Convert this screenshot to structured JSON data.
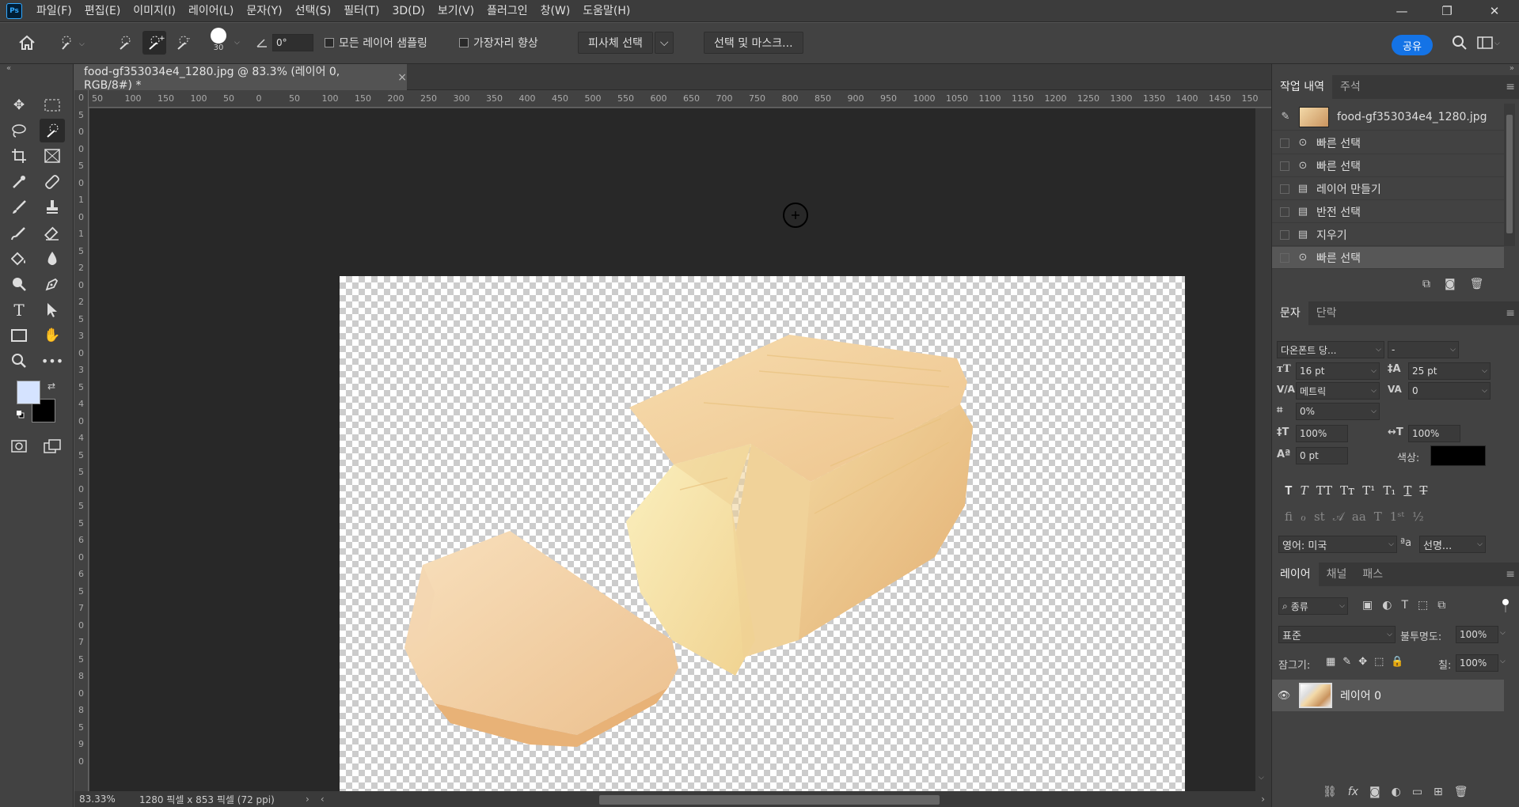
{
  "app": {
    "logo": "Ps"
  },
  "menu": [
    "파일(F)",
    "편집(E)",
    "이미지(I)",
    "레이어(L)",
    "문자(Y)",
    "선택(S)",
    "필터(T)",
    "3D(D)",
    "보기(V)",
    "플러그인",
    "창(W)",
    "도움말(H)"
  ],
  "window_controls": {
    "minimize": "—",
    "restore": "❐",
    "close": "✕"
  },
  "options": {
    "brush_size": "30",
    "angle": "0°",
    "sample_all_layers": "모든 레이어 샘플링",
    "enhance_edge": "가장자리 향상",
    "select_subject": "피사체 선택",
    "select_and_mask": "선택 및 마스크...",
    "share": "공유"
  },
  "document": {
    "tab_title": "food-gf353034e4_1280.jpg @ 83.3% (레이어 0, RGB/8#) *",
    "close": "×",
    "zoom": "83.33%",
    "dimensions": "1280 픽셀 x 853 픽셀 (72 ppi)"
  },
  "ruler_h": [
    "50",
    "100",
    "150",
    "100",
    "50",
    "0",
    "50",
    "100",
    "150",
    "200",
    "250",
    "300",
    "350",
    "400",
    "450",
    "500",
    "550",
    "600",
    "650",
    "700",
    "750",
    "800",
    "850",
    "900",
    "950",
    "1000",
    "1050",
    "1100",
    "1150",
    "1200",
    "1250",
    "1300",
    "1350",
    "1400",
    "1450",
    "150"
  ],
  "ruler_v": [
    "0",
    "5",
    "0",
    "0",
    "5",
    "0",
    "1",
    "0",
    "1",
    "5",
    "2",
    "0",
    "2",
    "5",
    "3",
    "0",
    "3",
    "5",
    "4",
    "0",
    "4",
    "5",
    "5",
    "0",
    "5",
    "5",
    "6",
    "0",
    "6",
    "5",
    "7",
    "0",
    "7",
    "5",
    "8",
    "0",
    "8",
    "5",
    "9",
    "0"
  ],
  "history": {
    "tabs": [
      "작업 내역",
      "주석"
    ],
    "snapshot": "food-gf353034e4_1280.jpg",
    "items": [
      {
        "label": "빠른 선택",
        "icon": "quick-select-icon"
      },
      {
        "label": "빠른 선택",
        "icon": "quick-select-icon"
      },
      {
        "label": "레이어 만들기",
        "icon": "document-icon"
      },
      {
        "label": "반전 선택",
        "icon": "document-icon"
      },
      {
        "label": "지우기",
        "icon": "document-icon"
      },
      {
        "label": "빠른 선택",
        "icon": "quick-select-icon"
      }
    ]
  },
  "character": {
    "tabs": [
      "문자",
      "단락"
    ],
    "font_family": "다온폰트 당...",
    "font_style": "-",
    "font_size": "16 pt",
    "leading": "25 pt",
    "kerning": "메트릭",
    "tracking": "0",
    "tsume": "0%",
    "vertical_scale": "100%",
    "horizontal_scale": "100%",
    "baseline_shift": "0 pt",
    "color_label": "색상:",
    "color": "#000000",
    "language": "영어: 미국",
    "aa_icon": "ªa",
    "antialias": "선명..."
  },
  "layers": {
    "tabs": [
      "레이어",
      "채널",
      "패스"
    ],
    "filter": "종류",
    "blend_mode": "표준",
    "opacity_label": "불투명도:",
    "opacity": "100%",
    "lock_label": "잠그기:",
    "fill_label": "칠:",
    "fill": "100%",
    "items": [
      {
        "name": "레이어 0",
        "visible": true
      }
    ]
  },
  "colors": {
    "foreground": "#d5e3ff",
    "background": "#000000",
    "accent": "#1473e6"
  }
}
